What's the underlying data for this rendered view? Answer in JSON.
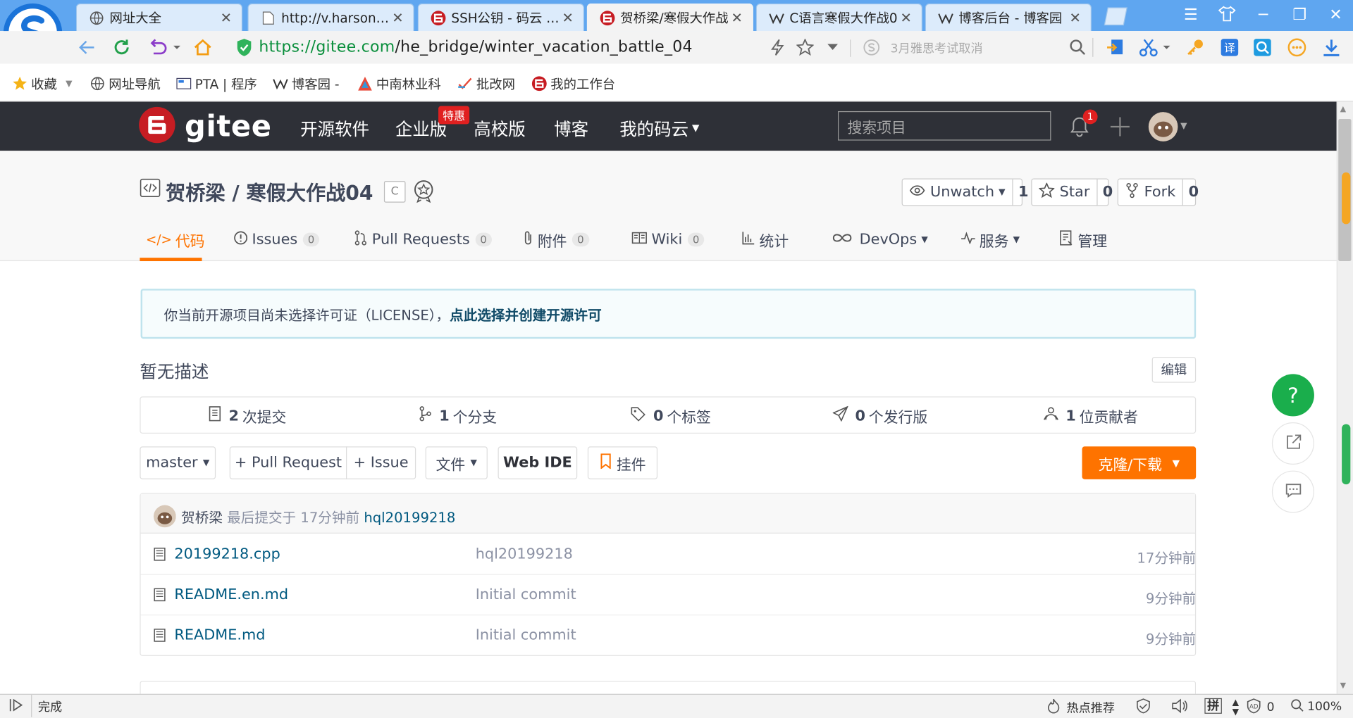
{
  "browser": {
    "tabs": [
      {
        "title": "网址大全"
      },
      {
        "title": "http://v.harson.co"
      },
      {
        "title": "SSH公钥 - 码云 Git"
      },
      {
        "title": "贺桥梁/寒假大作战"
      },
      {
        "title": "C语言寒假大作战0"
      },
      {
        "title": "博客后台 - 博客园"
      }
    ],
    "url_scheme": "https://",
    "url_host": "gitee.com",
    "url_path": "/he_bridge/winter_vacation_battle_04",
    "search_placeholder": "3月雅思考试取消",
    "bookmarks": [
      {
        "label": "收藏"
      },
      {
        "label": "网址导航"
      },
      {
        "label": "PTA | 程序"
      },
      {
        "label": "博客园 -"
      },
      {
        "label": "中南林业科"
      },
      {
        "label": "批改网"
      },
      {
        "label": "我的工作台"
      }
    ],
    "status": "完成",
    "hot": "热点推荐",
    "ime": "拼",
    "blocked": "0",
    "zoom": "100%"
  },
  "gitee": {
    "logo_text": "gitee",
    "nav": [
      "开源软件",
      "企业版",
      "高校版",
      "博客",
      "我的码云"
    ],
    "nav_badge": "特惠",
    "search_placeholder": "搜索项目",
    "notif_count": "1",
    "accent": "#fe7300"
  },
  "repo": {
    "title": "贺桥梁 / 寒假大作战04",
    "lang": "C",
    "unwatch": {
      "label": "Unwatch",
      "count": "1"
    },
    "star": {
      "label": "Star",
      "count": "0"
    },
    "fork": {
      "label": "Fork",
      "count": "0"
    },
    "tabs": [
      {
        "label": "代码"
      },
      {
        "label": "Issues",
        "count": "0"
      },
      {
        "label": "Pull Requests",
        "count": "0"
      },
      {
        "label": "附件",
        "count": "0"
      },
      {
        "label": "Wiki",
        "count": "0"
      },
      {
        "label": "统计"
      },
      {
        "label": "DevOps"
      },
      {
        "label": "服务"
      },
      {
        "label": "管理"
      }
    ],
    "license_text": "你当前开源项目尚未选择许可证（LICENSE），",
    "license_link": "点此选择并创建开源许可",
    "no_desc": "暂无描述",
    "edit": "编辑",
    "stats": [
      {
        "num": "2",
        "label": "次提交"
      },
      {
        "num": "1",
        "label": "个分支"
      },
      {
        "num": "0",
        "label": "个标签"
      },
      {
        "num": "0",
        "label": "个发行版"
      },
      {
        "num": "1",
        "label": "位贡献者"
      }
    ],
    "branch": "master",
    "actions": {
      "pr": "+ Pull Request",
      "issue": "+ Issue",
      "file": "文件",
      "webide": "Web IDE",
      "widget": "挂件",
      "clone": "克隆/下载"
    },
    "last_commit": {
      "author": "贺桥梁",
      "text": "最后提交于 17分钟前",
      "msg": "hql20199218"
    },
    "files": [
      {
        "name": "20199218.cpp",
        "msg": "hql20199218",
        "time": "17分钟前"
      },
      {
        "name": "README.en.md",
        "msg": "Initial commit",
        "time": "9分钟前"
      },
      {
        "name": "README.md",
        "msg": "Initial commit",
        "time": "9分钟前"
      }
    ],
    "help": "?"
  }
}
